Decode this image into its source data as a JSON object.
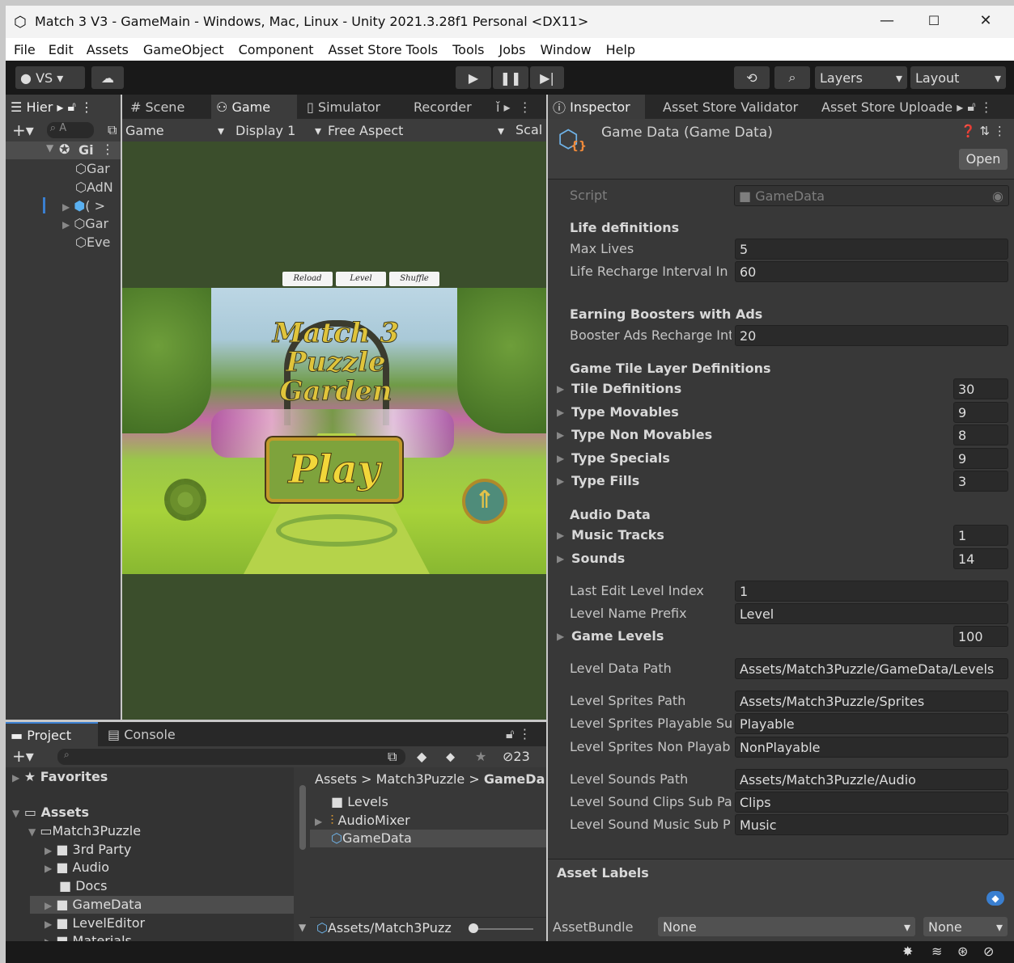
{
  "window": {
    "title": "Match 3 V3 - GameMain - Windows, Mac, Linux - Unity 2021.3.28f1 Personal <DX11>"
  },
  "menu": [
    "File",
    "Edit",
    "Assets",
    "GameObject",
    "Component",
    "Asset Store Tools",
    "Tools",
    "Jobs",
    "Window",
    "Help"
  ],
  "toolbar": {
    "account": "VS",
    "layers": "Layers",
    "layout": "Layout"
  },
  "hierarchy": {
    "tab": "Hier",
    "search": "A",
    "items": [
      "Gi",
      "Gar",
      "AdN",
      "(  >",
      "Gar",
      "Eve"
    ]
  },
  "scene_tabs": [
    "Scene",
    "Game",
    "Simulator",
    "Recorder"
  ],
  "game_bar": {
    "view": "Game",
    "display": "Display 1",
    "aspect": "Free Aspect",
    "scale": "Scal"
  },
  "game_view": {
    "buttons": [
      "Reload",
      "Level Editor",
      "Shuffle"
    ],
    "logo": [
      "Match 3",
      "Puzzle",
      "Garden"
    ],
    "play": "Play"
  },
  "inspector": {
    "tabs": [
      "Inspector",
      "Asset Store Validator",
      "Asset Store Uploade"
    ],
    "title": "Game Data (Game Data)",
    "open": "Open",
    "script_label": "Script",
    "script_value": "GameData",
    "h_life": "Life definitions",
    "max_lives_label": "Max Lives",
    "max_lives": "5",
    "recharge_label": "Life Recharge Interval In M",
    "recharge": "60",
    "h_boost": "Earning Boosters with Ads",
    "booster_label": "Booster Ads Recharge Inte",
    "booster": "20",
    "h_tile": "Game Tile Layer Definitions",
    "tile_def": "Tile Definitions",
    "tile_def_n": "30",
    "type_mov": "Type Movables",
    "type_mov_n": "9",
    "type_nonmov": "Type Non Movables",
    "type_nonmov_n": "8",
    "type_spec": "Type Specials",
    "type_spec_n": "9",
    "type_fills": "Type Fills",
    "type_fills_n": "3",
    "h_audio": "Audio Data",
    "music": "Music Tracks",
    "music_n": "1",
    "sounds": "Sounds",
    "sounds_n": "14",
    "last_edit_label": "Last Edit Level Index",
    "last_edit": "1",
    "prefix_label": "Level Name Prefix",
    "prefix": "Level",
    "game_levels": "Game Levels",
    "game_levels_n": "100",
    "data_path_label": "Level Data Path",
    "data_path": "Assets/Match3Puzzle/GameData/Levels",
    "sprites_path_label": "Level Sprites Path",
    "sprites_path": "Assets/Match3Puzzle/Sprites",
    "sprites_play_label": "Level Sprites Playable Su",
    "sprites_play": "Playable",
    "sprites_nonplay_label": "Level Sprites Non Playabl",
    "sprites_nonplay": "NonPlayable",
    "sounds_path_label": "Level Sounds Path",
    "sounds_path": "Assets/Match3Puzzle/Audio",
    "clips_label": "Level Sound Clips Sub Pa",
    "clips": "Clips",
    "music_sub_label": "Level Sound Music Sub P",
    "music_sub": "Music",
    "asset_labels": "Asset Labels",
    "assetbundle_label": "AssetBundle",
    "assetbundle": "None",
    "variant": "None"
  },
  "project": {
    "tabs": [
      "Project",
      "Console"
    ],
    "count": "23",
    "favorites": "Favorites",
    "tree": [
      "Assets",
      "Match3Puzzle",
      "3rd Party",
      "Audio",
      "Docs",
      "GameData",
      "LevelEditor",
      "Materials"
    ],
    "breadcrumb": [
      "Assets",
      "Match3Puzzle",
      "GameDa"
    ],
    "files": [
      "Levels",
      "AudioMixer",
      "GameData"
    ],
    "footer_path": "Assets/Match3Puzz"
  }
}
